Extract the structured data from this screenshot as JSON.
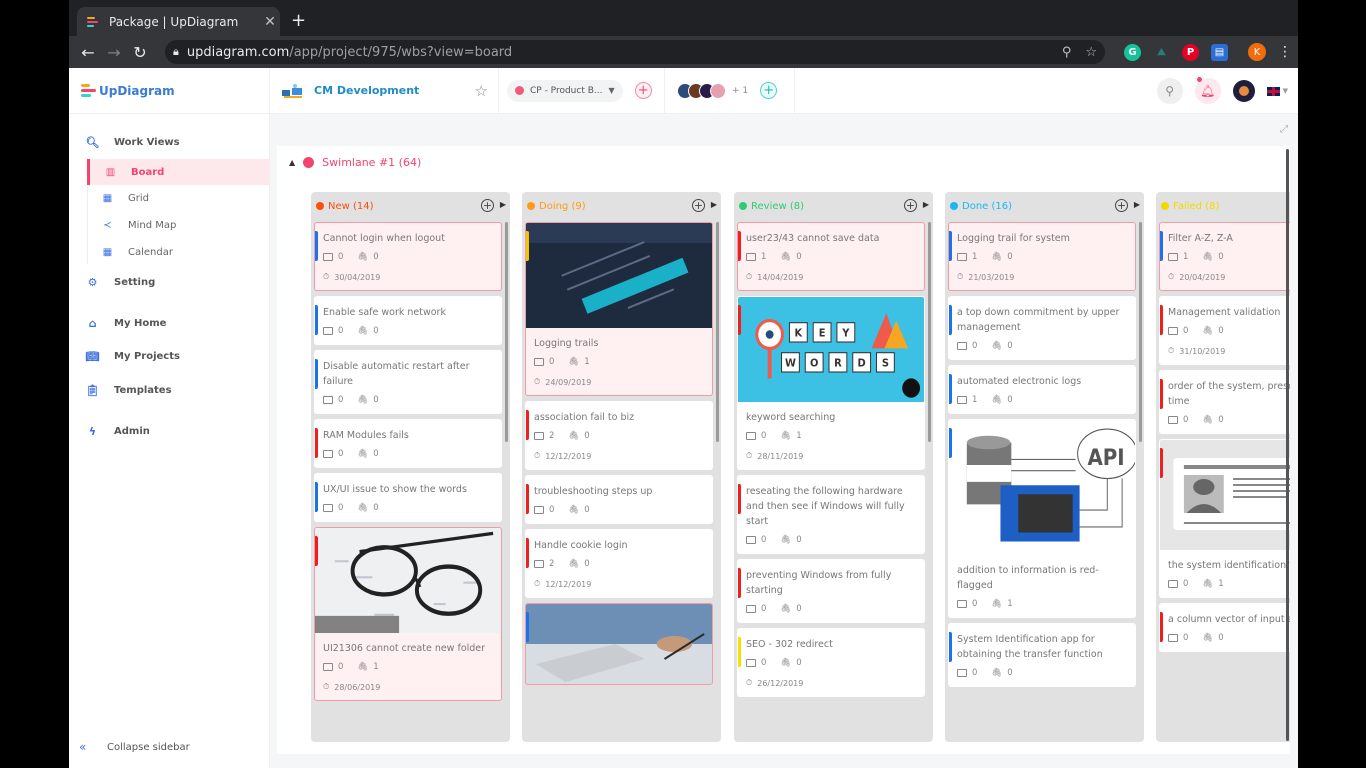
{
  "browser": {
    "tab_title": "Package | UpDiagram",
    "url_domain": "updiagram.com",
    "url_path": "/app/project/975/wbs?view=board",
    "profile_initial": "K"
  },
  "header": {
    "app_name": "UpDiagram",
    "project_name": "CM Development",
    "package_select": "CP - Product B...",
    "members_more": "+ 1"
  },
  "sidebar": {
    "work_views": "Work Views",
    "views": [
      {
        "label": "Board",
        "icon": "board-icon",
        "active": true
      },
      {
        "label": "Grid",
        "icon": "grid-icon"
      },
      {
        "label": "Mind Map",
        "icon": "mind-map-icon"
      },
      {
        "label": "Calendar",
        "icon": "calendar-icon"
      }
    ],
    "items": [
      {
        "label": "Setting",
        "icon": "gear-icon"
      },
      {
        "label": "My Home",
        "icon": "home-icon"
      },
      {
        "label": "My Projects",
        "icon": "book-icon"
      },
      {
        "label": "Templates",
        "icon": "clipboard-icon"
      },
      {
        "label": "Admin",
        "icon": "bolt-icon"
      }
    ],
    "collapse": "Collapse sidebar"
  },
  "board": {
    "swimlane": "Swimlane #1 (64)",
    "columns": [
      {
        "name": "New (14)",
        "color": "#ff4d0a",
        "cards": [
          {
            "title": "Cannot login when logout",
            "comments": "0",
            "attachments": "0",
            "date": "30/04/2019",
            "flag": "#1a73e8",
            "highlight": true
          },
          {
            "title": "Enable safe work network",
            "comments": "0",
            "attachments": "0",
            "flag": "#1a73e8"
          },
          {
            "title": "Disable automatic restart after failure",
            "comments": "0",
            "attachments": "0",
            "flag": "#1a73e8"
          },
          {
            "title": "RAM Modules fails",
            "comments": "0",
            "attachments": "0",
            "flag": "#f01e1e"
          },
          {
            "title": "UX/UI issue to show the words",
            "comments": "0",
            "attachments": "0",
            "flag": "#1a73e8"
          },
          {
            "title": "UI21306 cannot create new folder",
            "comments": "0",
            "attachments": "1",
            "date": "28/06/2019",
            "flag": "#f01e1e",
            "highlight": true,
            "image": "glasses"
          }
        ]
      },
      {
        "name": "Doing (9)",
        "color": "#ff9a1a",
        "cards": [
          {
            "title": "Logging trails",
            "comments": "0",
            "attachments": "1",
            "date": "24/09/2019",
            "flag": "#f5c400",
            "highlight": true,
            "image": "login"
          },
          {
            "title": "association fail to biz",
            "comments": "2",
            "attachments": "0",
            "date": "12/12/2019",
            "flag": "#f01e1e"
          },
          {
            "title": "troubleshooting steps up",
            "comments": "0",
            "attachments": "0",
            "flag": "#f01e1e"
          },
          {
            "title": "Handle cookie login",
            "comments": "2",
            "attachments": "0",
            "date": "12/12/2019",
            "flag": "#f01e1e"
          },
          {
            "title": "",
            "comments": "",
            "attachments": "",
            "flag": "#1a73e8",
            "highlight": true,
            "image": "laptop"
          }
        ]
      },
      {
        "name": "Review (8)",
        "color": "#2ecc71",
        "cards": [
          {
            "title": "user23/43 cannot save data",
            "comments": "1",
            "attachments": "0",
            "date": "14/04/2019",
            "flag": "#f01e1e",
            "highlight": true
          },
          {
            "title": "keyword searching",
            "comments": "0",
            "attachments": "1",
            "date": "28/11/2019",
            "flag": "#f01e1e",
            "image": "keywords"
          },
          {
            "title": "reseating the following hardware and then see if Windows will fully start",
            "comments": "0",
            "attachments": "0",
            "flag": "#f01e1e"
          },
          {
            "title": "preventing Windows from fully starting",
            "comments": "0",
            "attachments": "0",
            "flag": "#f01e1e"
          },
          {
            "title": "SEO - 302 redirect",
            "comments": "0",
            "attachments": "0",
            "date": "26/12/2019",
            "flag": "#f5e000"
          }
        ]
      },
      {
        "name": "Done (16)",
        "color": "#1ab8f0",
        "cards": [
          {
            "title": "Logging trail for system",
            "comments": "1",
            "attachments": "0",
            "date": "21/03/2019",
            "flag": "#1a73e8",
            "highlight": true
          },
          {
            "title": "a top down commitment by upper management",
            "comments": "0",
            "attachments": "0",
            "flag": "#1a73e8"
          },
          {
            "title": "automated electronic logs",
            "comments": "1",
            "attachments": "0",
            "flag": "#1a73e8"
          },
          {
            "title": "addition to information is red-flagged",
            "comments": "0",
            "attachments": "1",
            "flag": "#1a73e8",
            "image": "api"
          },
          {
            "title": "System Identification app for obtaining the transfer function",
            "comments": "0",
            "attachments": "0",
            "flag": "#1a73e8"
          }
        ]
      },
      {
        "name": "Failed (8)",
        "color": "#f5d800",
        "cards": [
          {
            "title": "Filter A-Z, Z-A",
            "comments": "1",
            "attachments": "0",
            "date": "20/04/2019",
            "flag": "#1a73e8",
            "highlight": true
          },
          {
            "title": "Management validation",
            "comments": "0",
            "attachments": "0",
            "date": "31/10/2019",
            "flag": "#f01e1e"
          },
          {
            "title": "order of the system, prese delay time",
            "comments": "0",
            "attachments": "0",
            "flag": "#f01e1e"
          },
          {
            "title": "the system identification t",
            "comments": "0",
            "attachments": "1",
            "flag": "#f01e1e",
            "image": "idcard"
          },
          {
            "title": "a column vector of input a output",
            "comments": "0",
            "attachments": "0",
            "flag": "#f01e1e"
          }
        ]
      }
    ]
  }
}
